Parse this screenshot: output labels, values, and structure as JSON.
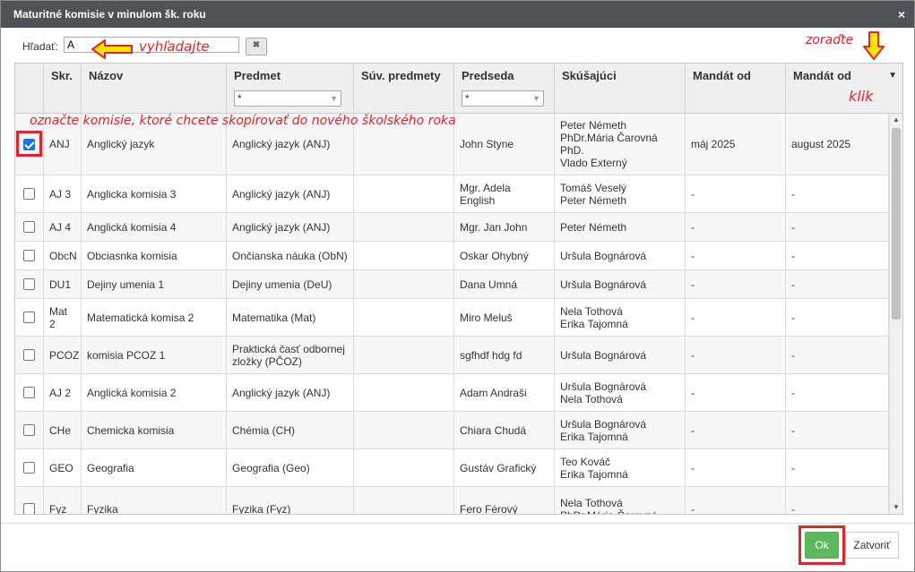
{
  "dialog": {
    "title": "Maturitné komisie v minulom šk. roku",
    "close_icon": "×"
  },
  "search": {
    "label": "Hľadať:",
    "value": "A",
    "clear_label": "✖"
  },
  "annotations": {
    "search": "vyhľadajte",
    "sort": "zoraďte",
    "klik": "klik",
    "select": "označte komisie, ktoré chcete skopírovať do nového školského roka",
    "color": "#e3242b"
  },
  "columns": {
    "skr": "Skr.",
    "nazov": "Názov",
    "predmet": "Predmet",
    "suv": "Súv. predmety",
    "predseda": "Predseda",
    "skusajuci": "Skúšajúci",
    "mandat_od": "Mandát od",
    "mandat_do": "Mandát od",
    "filter_predmet": "*",
    "filter_predseda": "*",
    "sort_indicator": "▼"
  },
  "rows": [
    {
      "checked": true,
      "skr": "ANJ",
      "nazov": "Anglický jazyk",
      "predmet": "Anglický jazyk (ANJ)",
      "suv": "",
      "predseda": "John Styne",
      "skusajuci": "Peter Németh\nPhDr.Mária Čarovná\nPhD.\nVlado Externý",
      "mandat_od": "máj 2025",
      "mandat_do": "august 2025"
    },
    {
      "checked": false,
      "skr": "AJ 3",
      "nazov": "Anglicka komisia 3",
      "predmet": "Anglický jazyk (ANJ)",
      "suv": "",
      "predseda": "Mgr. Adela\nEnglish",
      "skusajuci": "Tomáš Veselý\nPeter Németh",
      "mandat_od": "-",
      "mandat_do": "-"
    },
    {
      "checked": false,
      "skr": "AJ 4",
      "nazov": "Anglická komisia 4",
      "predmet": "Anglický jazyk (ANJ)",
      "suv": "",
      "predseda": "Mgr. Jan John",
      "skusajuci": "Peter Németh",
      "mandat_od": "-",
      "mandat_do": "-"
    },
    {
      "checked": false,
      "skr": "ObcN",
      "nazov": "Obciasnka komisia",
      "predmet": "Ončianska náuka (ObN)",
      "suv": "",
      "predseda": "Oskar Ohybný",
      "skusajuci": "Uršula Bognárová",
      "mandat_od": "-",
      "mandat_do": "-"
    },
    {
      "checked": false,
      "skr": "DU1",
      "nazov": "Dejiny umenia 1",
      "predmet": "Dejiny umenia (DeU)",
      "suv": "",
      "predseda": "Dana Umná",
      "skusajuci": "Uršula Bognárová",
      "mandat_od": "-",
      "mandat_do": "-"
    },
    {
      "checked": false,
      "skr": "Mat\n2",
      "nazov": "Matematická komisa 2",
      "predmet": "Matematika (Mat)",
      "suv": "",
      "predseda": "Miro Meluš",
      "skusajuci": "Nela Tothová\nErika Tajomná",
      "mandat_od": "-",
      "mandat_do": "-"
    },
    {
      "checked": false,
      "skr": "PCOZ",
      "nazov": "komisia PCOZ 1",
      "predmet": "Praktická časť odbornej\nzložky (PČOZ)",
      "suv": "",
      "predseda": "sgfhdf hdg fd",
      "skusajuci": "Uršula Bognárová",
      "mandat_od": "-",
      "mandat_do": "-"
    },
    {
      "checked": false,
      "skr": "AJ 2",
      "nazov": "Anglická komisia 2",
      "predmet": "Anglický jazyk (ANJ)",
      "suv": "",
      "predseda": "Adam Andraši",
      "skusajuci": "Uršula Bognárová\nNela Tothová",
      "mandat_od": "-",
      "mandat_do": "-"
    },
    {
      "checked": false,
      "skr": "CHe",
      "nazov": "Chemicka komisia",
      "predmet": "Chémia (CH)",
      "suv": "",
      "predseda": "Chiara Chudá",
      "skusajuci": "Uršula Bognárová\nErika Tajomná",
      "mandat_od": "-",
      "mandat_do": "-"
    },
    {
      "checked": false,
      "skr": "GEO",
      "nazov": "Geografia",
      "predmet": "Geografia (Geo)",
      "suv": "",
      "predseda": "Gustáv Grafický",
      "skusajuci": "Teo Kováč\nErika Tajomná",
      "mandat_od": "-",
      "mandat_do": "-"
    },
    {
      "checked": false,
      "skr": "Fyz",
      "nazov": "Fyzika",
      "predmet": "Fyzika (Fyz)",
      "suv": "",
      "predseda": "Fero Férový",
      "skusajuci": "Nela Tothová\nPhDr.Mária Čarovná",
      "mandat_od": "-",
      "mandat_do": "-"
    }
  ],
  "footer": {
    "ok_label": "Ok",
    "close_label": "Zatvoriť"
  }
}
